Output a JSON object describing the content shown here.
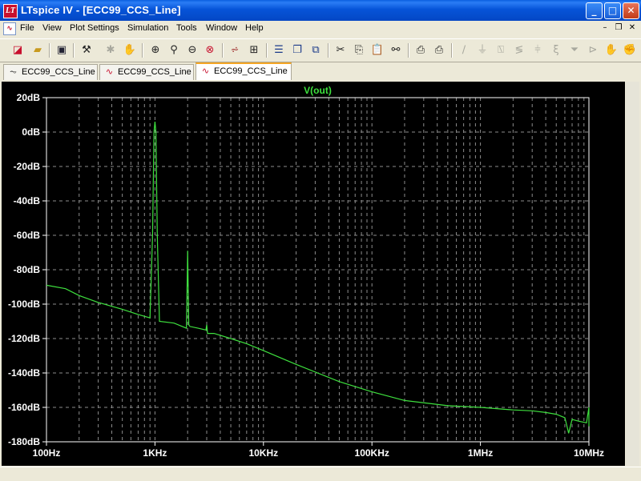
{
  "window": {
    "title": "LTspice IV - [ECC99_CCS_Line]",
    "app_icon_text": "LT",
    "buttons": {
      "minimize": "_",
      "maximize": "□",
      "close": "✕"
    }
  },
  "menu": {
    "items": [
      "File",
      "View",
      "Plot Settings",
      "Simulation",
      "Tools",
      "Window",
      "Help"
    ],
    "mdi": {
      "minimize": "–",
      "restore": "❐",
      "close": "✕"
    }
  },
  "toolbar": {
    "icons": [
      "new-schematic-icon",
      "open-icon",
      "save-icon",
      "control-panel-icon",
      "run-icon",
      "halt-icon",
      "zoom-in-icon",
      "zoom-pan-icon",
      "zoom-out-icon",
      "zoom-cancel-icon",
      "autorange-icon",
      "pick-visible-icon",
      "tile-horizontal-icon",
      "cascade-icon",
      "close-all-icon",
      "cut-icon",
      "copy-icon",
      "paste-icon",
      "find-icon",
      "print-setup-icon",
      "print-icon",
      "wire-icon",
      "ground-icon",
      "label-icon",
      "resistor-icon",
      "capacitor-icon",
      "inductor-icon",
      "diode-icon",
      "component-icon",
      "move-icon",
      "drag-icon"
    ]
  },
  "tabs": [
    {
      "label": "ECC99_CCS_Line",
      "icon": "schematic-icon",
      "active": false
    },
    {
      "label": "ECC99_CCS_Line",
      "icon": "waveform-icon",
      "active": false
    },
    {
      "label": "ECC99_CCS_Line",
      "icon": "waveform-icon",
      "active": true
    }
  ],
  "chart_data": {
    "type": "line",
    "title": "V(out)",
    "x_scale": "log",
    "xlim": [
      100,
      10000000
    ],
    "ylim": [
      -180,
      20
    ],
    "x_ticks": [
      "100Hz",
      "1KHz",
      "10KHz",
      "100KHz",
      "1MHz",
      "10MHz"
    ],
    "y_ticks": [
      "20dB",
      "0dB",
      "-20dB",
      "-40dB",
      "-60dB",
      "-80dB",
      "-100dB",
      "-120dB",
      "-140dB",
      "-160dB",
      "-180dB"
    ],
    "grid": true,
    "colors": {
      "background": "#000000",
      "trace": "#3ee03e",
      "grid": "#8c8c8c",
      "axis_text": "#ffffff"
    },
    "series": [
      {
        "name": "V(out)",
        "x": [
          100,
          150,
          200,
          300,
          500,
          700,
          900,
          950,
          980,
          1000,
          1020,
          1050,
          1100,
          1500,
          1950,
          2000,
          2050,
          2100,
          2500,
          2950,
          3000,
          3050,
          3500,
          5000,
          7000,
          10000,
          20000,
          50000,
          100000,
          200000,
          500000,
          1000000,
          2000000,
          3000000,
          4000000,
          5000000,
          6000000,
          6500000,
          7000000,
          8000000,
          9500000,
          10000000,
          10500000,
          12000000
        ],
        "y": [
          -89,
          -91,
          -95,
          -99,
          -103,
          -106,
          -108,
          -60,
          0,
          6,
          0,
          -60,
          -110,
          -111,
          -114,
          -69,
          -112,
          -113,
          -114,
          -115,
          -112,
          -117,
          -117,
          -120,
          -123,
          -127,
          -135,
          -145,
          -151,
          -156,
          -159,
          -160,
          -161.5,
          -162,
          -163,
          -164,
          -166,
          -175,
          -167,
          -168,
          -169,
          -160,
          -170,
          -171
        ]
      }
    ]
  }
}
